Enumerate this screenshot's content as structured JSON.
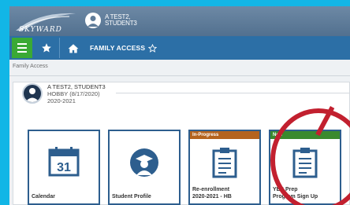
{
  "header": {
    "logo_text": "SKYWARD",
    "user_name_line1": "A TEST2,",
    "user_name_line2": "STUDENT3"
  },
  "nav": {
    "title": "FAMILY ACCESS"
  },
  "breadcrumb": "Family Access",
  "student": {
    "name": "A TEST2, STUDENT3",
    "hobby": "HOBBY (8/17/2020)",
    "year": "2020-2021"
  },
  "tiles": [
    {
      "label": "Calendar",
      "icon": "calendar-icon",
      "icon_text": "31",
      "banner": ""
    },
    {
      "label": "Student Profile",
      "icon": "graduate-icon",
      "banner": ""
    },
    {
      "label_line1": "Re-enrollment",
      "label_line2": "2020-2021 - HB",
      "icon": "clipboard-icon",
      "banner": "In-Progress"
    },
    {
      "label_line1": "YES Prep",
      "label_line2": "Program Sign Up",
      "icon": "clipboard-icon",
      "banner": "New"
    }
  ],
  "colors": {
    "background": "#12b6e6",
    "header": "#5f7c99",
    "nav": "#2c6fa6",
    "menu_button": "#3aa935",
    "tile_border": "#2d5e8e",
    "in_progress": "#b4631e",
    "new": "#3a8a2e",
    "annotation": "#c2202f"
  }
}
